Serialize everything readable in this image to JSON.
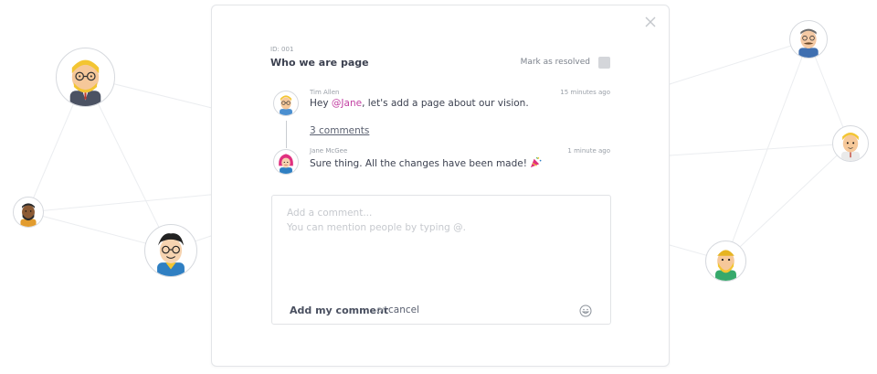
{
  "page": {
    "id_label": "ID: 001",
    "title": "Who we are page"
  },
  "resolve": {
    "label": "Mark as resolved",
    "checked": false
  },
  "comments": [
    {
      "author": "Tim Allen",
      "time": "15 minutes ago",
      "text_before": "Hey ",
      "mention": "@Jane",
      "text_after": ", let's add a page about our vision."
    },
    {
      "author": "Jane McGee",
      "time": "1 minute ago",
      "text": "Sure thing. All the changes have been made!",
      "emoji": "party-popper-icon"
    }
  ],
  "thread": {
    "comments_link": "3 comments"
  },
  "composer": {
    "placeholder_line1": "Add a comment...",
    "placeholder_line2": "You can mention people by typing @.",
    "submit_label": "Add my comment",
    "or_label": "or",
    "cancel_label": "cancel"
  },
  "colors": {
    "mention": "#c23fa2",
    "accent": "#3c4150"
  }
}
